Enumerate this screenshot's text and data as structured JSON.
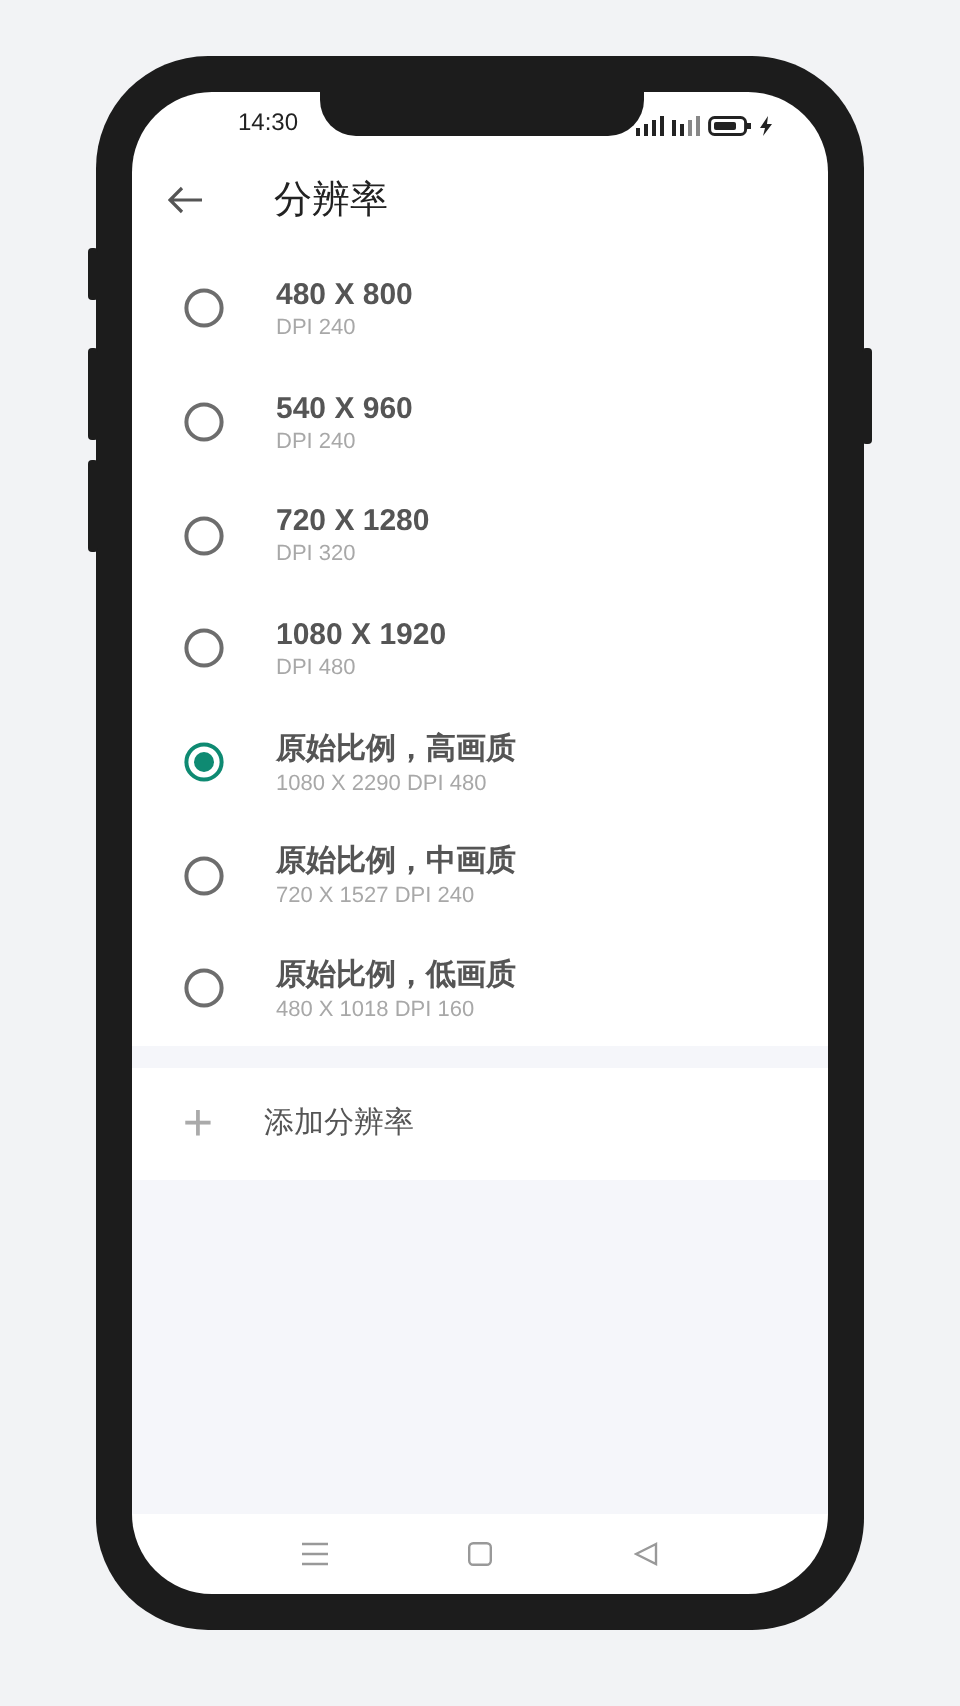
{
  "status_bar": {
    "time": "14:30"
  },
  "header": {
    "title": "分辨率"
  },
  "options": [
    {
      "label": "480 X 800",
      "detail": "DPI 240",
      "selected": false
    },
    {
      "label": "540 X 960",
      "detail": "DPI 240",
      "selected": false
    },
    {
      "label": "720 X 1280",
      "detail": "DPI 320",
      "selected": false
    },
    {
      "label": "1080 X 1920",
      "detail": "DPI 480",
      "selected": false
    },
    {
      "label": "原始比例，高画质",
      "detail": "1080 X 2290 DPI 480",
      "selected": true
    },
    {
      "label": "原始比例，中画质",
      "detail": "720 X 1527 DPI 240",
      "selected": false
    },
    {
      "label": "原始比例，低画质",
      "detail": "480 X 1018 DPI 160",
      "selected": false
    }
  ],
  "add_button": {
    "icon": "+",
    "label": "添加分辨率"
  }
}
